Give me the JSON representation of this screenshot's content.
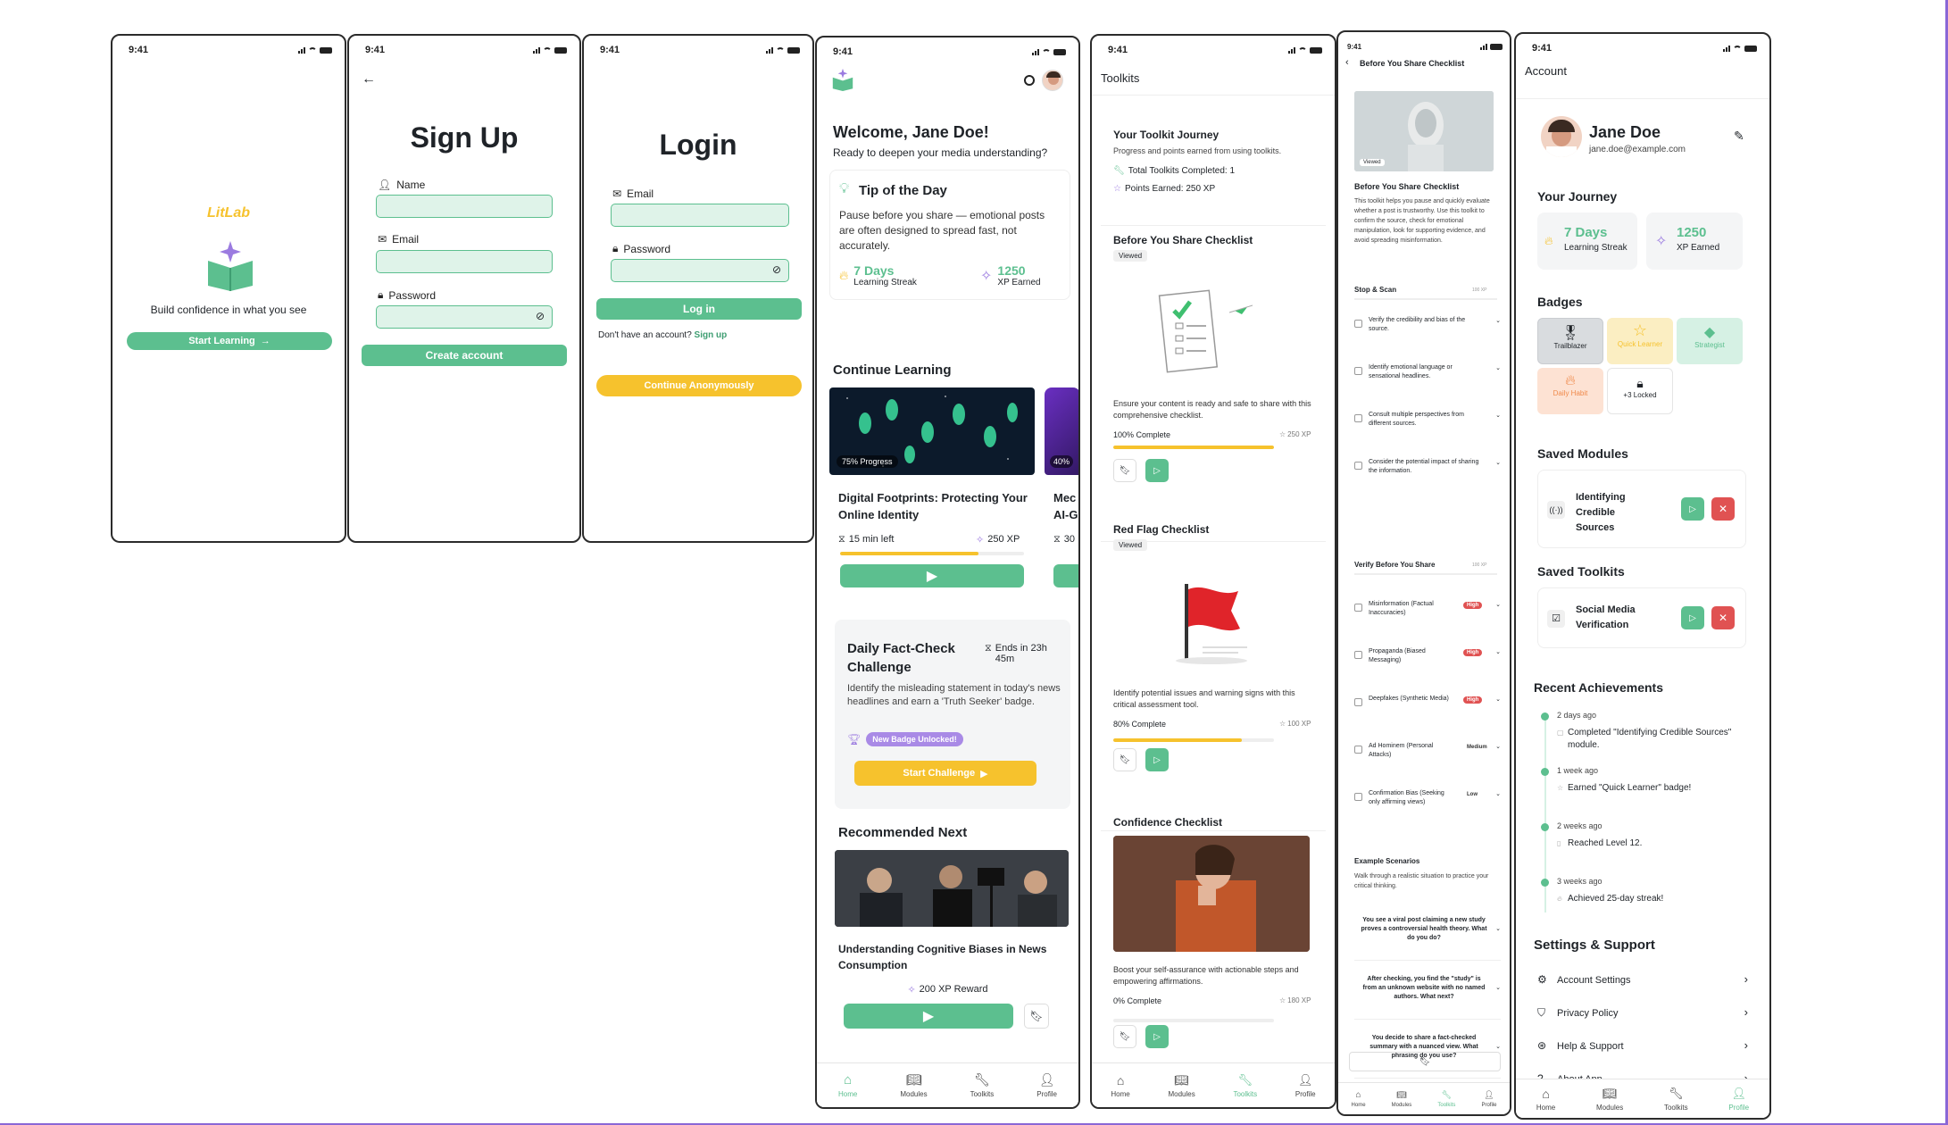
{
  "time": "9:41",
  "colors": {
    "primary": "#5cbf8f",
    "accent": "#f6c22d",
    "danger": "#e05252",
    "purple": "#8a67d6"
  },
  "splash": {
    "brand": "LitLab",
    "tagline": "Build confidence in what you see",
    "cta": "Start Learning"
  },
  "signup": {
    "title": "Sign Up",
    "name_label": "Name",
    "email_label": "Email",
    "password_label": "Password",
    "cta": "Create account"
  },
  "login": {
    "title": "Login",
    "email_label": "Email",
    "password_label": "Password",
    "cta": "Log in",
    "no_account": "Don't have an account?",
    "signup_link": "Sign up",
    "anon": "Continue Anonymously"
  },
  "home": {
    "welcome": "Welcome, Jane Doe!",
    "subtitle": "Ready to deepen your media understanding?",
    "tip_title": "Tip of the Day",
    "tip_text": "Pause before you share — emotional posts are often designed to spread fast, not accurately.",
    "streak_value": "7 Days",
    "streak_label": "Learning Streak",
    "xp_value": "1250",
    "xp_label": "XP Earned",
    "continue_title": "Continue Learning",
    "course": {
      "badge": "75% Progress",
      "progress": 0.75,
      "title": "Digital Footprints: Protecting Your Online Identity",
      "time": "15 min left",
      "xp": "250 XP"
    },
    "course2": {
      "badge": "40%",
      "title": "Mec",
      "title2": "AI-G",
      "xp": "30"
    },
    "challenge": {
      "title": "Daily Fact-Check Challenge",
      "ends": "Ends in 23h 45m",
      "text": "Identify the misleading statement in today's news headlines and earn a 'Truth Seeker' badge.",
      "badge": "New Badge Unlocked!",
      "cta": "Start Challenge"
    },
    "recommended_title": "Recommended Next",
    "rec": {
      "title": "Understanding Cognitive Biases in News Consumption",
      "reward": "200 XP Reward"
    }
  },
  "tabs": {
    "home": "Home",
    "modules": "Modules",
    "toolkits": "Toolkits",
    "profile": "Profile"
  },
  "toolkits": {
    "header": "Toolkits",
    "journey_title": "Your Toolkit Journey",
    "journey_sub": "Progress and points earned from using toolkits.",
    "total": "Total Toolkits Completed: 1",
    "points": "Points Earned: 250 XP",
    "items": [
      {
        "title": "Before You Share Checklist",
        "tag": "Viewed",
        "desc": "Ensure your content is ready and safe to share with this comprehensive checklist.",
        "complete": "100% Complete",
        "xp": "250 XP",
        "progress": 1.0
      },
      {
        "title": "Red Flag Checklist",
        "tag": "Viewed",
        "desc": "Identify potential issues and warning signs with this critical assessment tool.",
        "complete": "80% Complete",
        "xp": "100 XP",
        "progress": 0.8
      },
      {
        "title": "Confidence Checklist",
        "desc": "Boost your self-assurance with actionable steps and empowering affirmations.",
        "complete": "0% Complete",
        "xp": "180 XP",
        "progress": 0.0
      }
    ]
  },
  "checklist": {
    "header": "Before You Share Checklist",
    "img_tag": "Viewed",
    "title": "Before You Share Checklist",
    "desc": "This toolkit helps you pause and quickly evaluate whether a post is trustworthy. Use this toolkit to confirm the source, check for emotional manipulation, look for supporting evidence, and avoid spreading misinformation.",
    "sec1": "Stop & Scan",
    "sec1_xp": "100 XP",
    "items1": [
      "Verify the credibility and bias of the source.",
      "Identify emotional language or sensational headlines.",
      "Consult multiple perspectives from different sources.",
      "Consider the potential impact of sharing the information."
    ],
    "sec2": "Verify Before You Share",
    "sec2_xp": "100 XP",
    "items2": [
      {
        "text": "Misinformation (Factual Inaccuracies)",
        "level": "High"
      },
      {
        "text": "Propaganda (Biased Messaging)",
        "level": "High"
      },
      {
        "text": "Deepfakes (Synthetic Media)",
        "level": "High"
      },
      {
        "text": "Ad Hominem (Personal Attacks)",
        "level": "Medium"
      },
      {
        "text": "Confirmation Bias (Seeking only affirming views)",
        "level": "Low"
      }
    ],
    "sec3": "Example Scenarios",
    "sec3_sub": "Walk through a realistic situation to practice your critical thinking.",
    "scenarios": [
      "You see a viral post claiming a new study proves a controversial health theory. What do you do?",
      "After checking, you find the \"study\" is from an unknown website with no named authors. What next?",
      "You decide to share a fact-checked summary with a nuanced view. What phrasing do you use?"
    ]
  },
  "account": {
    "header": "Account",
    "name": "Jane Doe",
    "email": "jane.doe@example.com",
    "journey_title": "Your Journey",
    "streak_value": "7 Days",
    "streak_label": "Learning Streak",
    "xp_value": "1250",
    "xp_label": "XP Earned",
    "badges_title": "Badges",
    "badges": [
      "Trailblazer",
      "Quick Learner",
      "Strategist",
      "Daily Habit",
      "+3 Locked"
    ],
    "saved_modules_title": "Saved Modules",
    "saved_module": "Identifying Credible Sources",
    "saved_toolkits_title": "Saved Toolkits",
    "saved_toolkit": "Social Media Verification",
    "recent_title": "Recent Achievements",
    "recent": [
      {
        "when": "2 days ago",
        "what": "Completed \"Identifying Credible Sources\" module."
      },
      {
        "when": "1 week ago",
        "what": "Earned \"Quick Learner\" badge!"
      },
      {
        "when": "2 weeks ago",
        "what": "Reached Level 12."
      },
      {
        "when": "3 weeks ago",
        "what": "Achieved 25-day streak!"
      }
    ],
    "settings_title": "Settings & Support",
    "settings": [
      "Account Settings",
      "Privacy Policy",
      "Help & Support",
      "About App"
    ]
  }
}
